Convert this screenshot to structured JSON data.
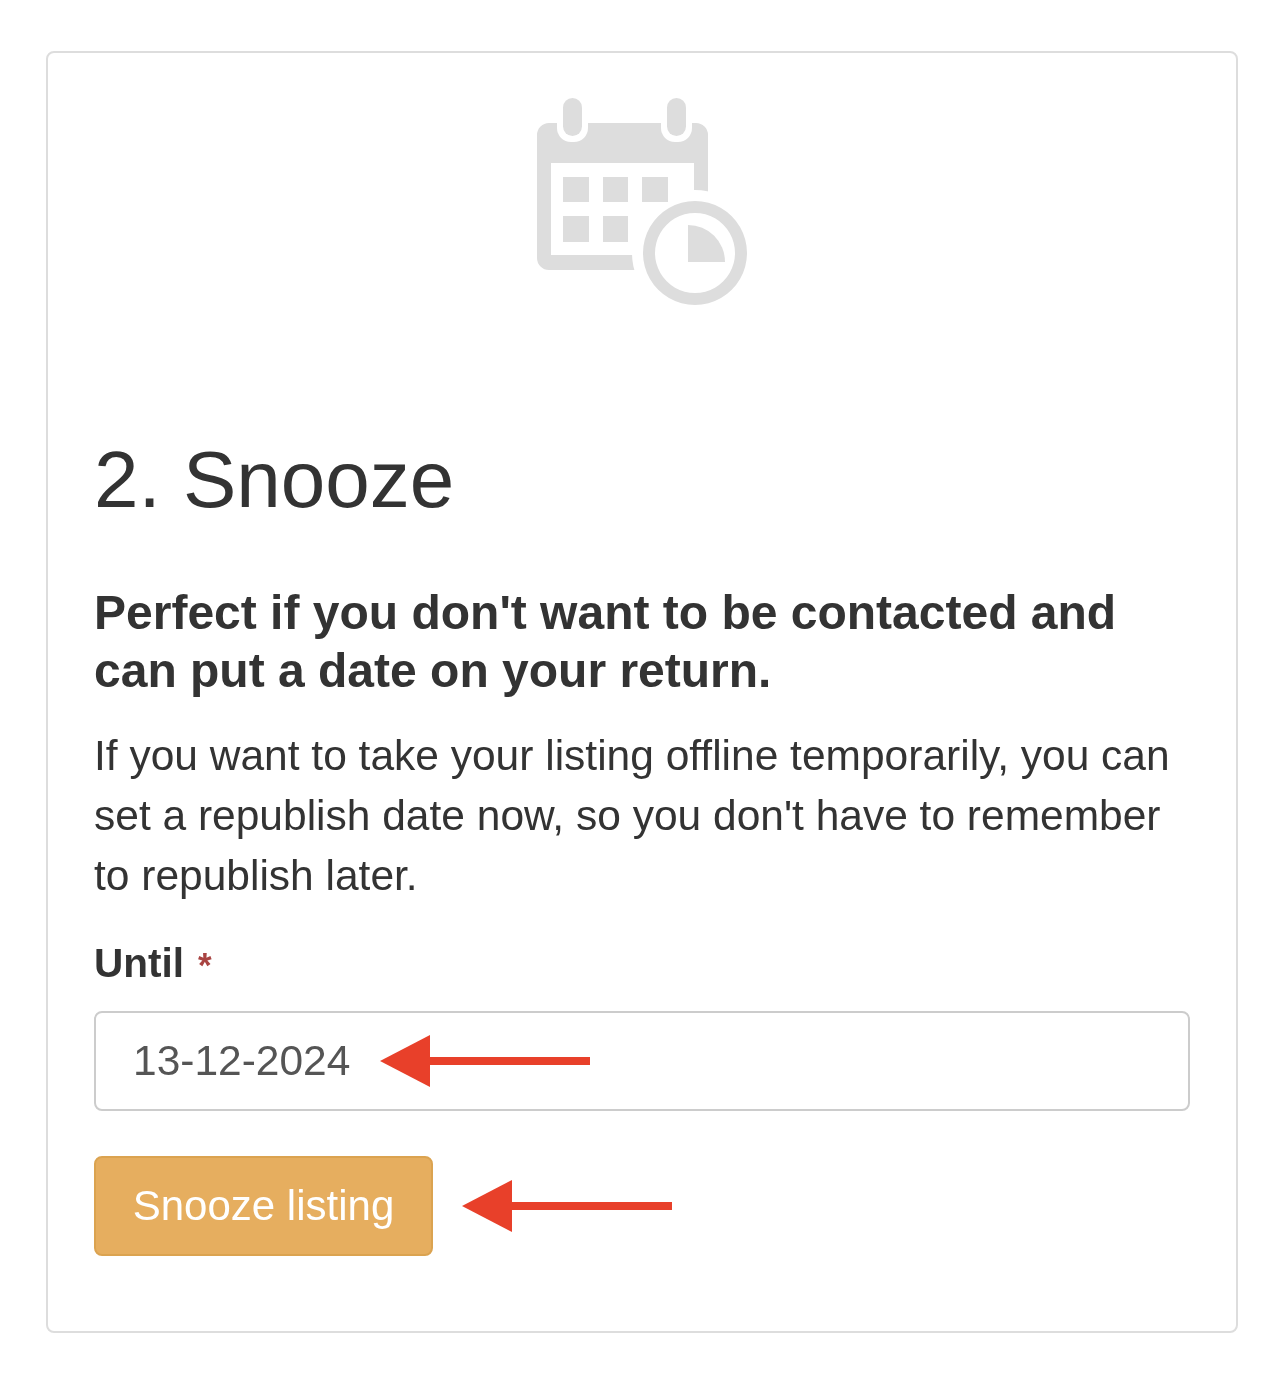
{
  "card": {
    "heading": "2. Snooze",
    "subheading": "Perfect if you don't want to be contacted and can put a date on your return.",
    "description": "If you want to take your listing offline temporarily, you can set a republish date now, so you don't have to remember to republish later.",
    "field": {
      "label": "Until",
      "required_mark": "*",
      "value": "13-12-2024",
      "pointed_at": true
    },
    "button": {
      "label": "Snooze listing",
      "pointed_at": true
    }
  }
}
